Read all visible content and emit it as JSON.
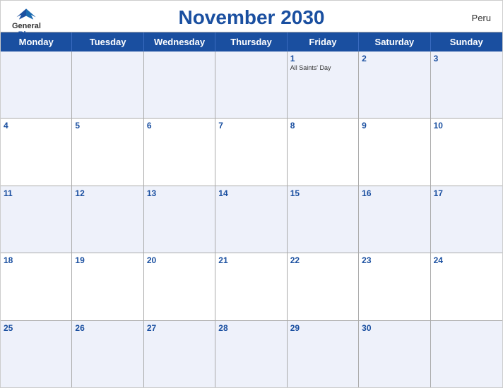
{
  "header": {
    "title": "November 2030",
    "country": "Peru",
    "logo": {
      "general": "General",
      "blue": "Blue"
    }
  },
  "dayHeaders": [
    "Monday",
    "Tuesday",
    "Wednesday",
    "Thursday",
    "Friday",
    "Saturday",
    "Sunday"
  ],
  "weeks": [
    [
      {
        "day": "",
        "holiday": ""
      },
      {
        "day": "",
        "holiday": ""
      },
      {
        "day": "",
        "holiday": ""
      },
      {
        "day": "",
        "holiday": ""
      },
      {
        "day": "1",
        "holiday": "All Saints' Day"
      },
      {
        "day": "2",
        "holiday": ""
      },
      {
        "day": "3",
        "holiday": ""
      }
    ],
    [
      {
        "day": "4",
        "holiday": ""
      },
      {
        "day": "5",
        "holiday": ""
      },
      {
        "day": "6",
        "holiday": ""
      },
      {
        "day": "7",
        "holiday": ""
      },
      {
        "day": "8",
        "holiday": ""
      },
      {
        "day": "9",
        "holiday": ""
      },
      {
        "day": "10",
        "holiday": ""
      }
    ],
    [
      {
        "day": "11",
        "holiday": ""
      },
      {
        "day": "12",
        "holiday": ""
      },
      {
        "day": "13",
        "holiday": ""
      },
      {
        "day": "14",
        "holiday": ""
      },
      {
        "day": "15",
        "holiday": ""
      },
      {
        "day": "16",
        "holiday": ""
      },
      {
        "day": "17",
        "holiday": ""
      }
    ],
    [
      {
        "day": "18",
        "holiday": ""
      },
      {
        "day": "19",
        "holiday": ""
      },
      {
        "day": "20",
        "holiday": ""
      },
      {
        "day": "21",
        "holiday": ""
      },
      {
        "day": "22",
        "holiday": ""
      },
      {
        "day": "23",
        "holiday": ""
      },
      {
        "day": "24",
        "holiday": ""
      }
    ],
    [
      {
        "day": "25",
        "holiday": ""
      },
      {
        "day": "26",
        "holiday": ""
      },
      {
        "day": "27",
        "holiday": ""
      },
      {
        "day": "28",
        "holiday": ""
      },
      {
        "day": "29",
        "holiday": ""
      },
      {
        "day": "30",
        "holiday": ""
      },
      {
        "day": "",
        "holiday": ""
      }
    ]
  ]
}
